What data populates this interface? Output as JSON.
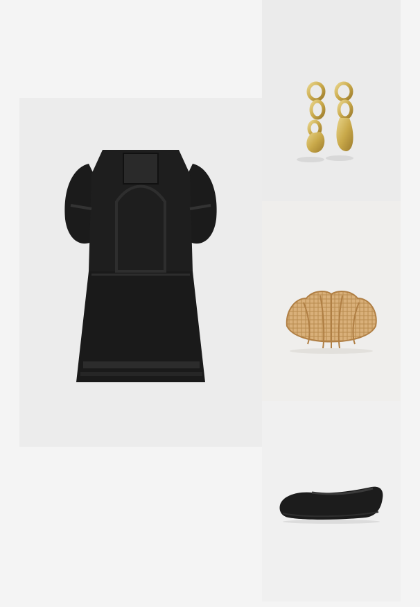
{
  "outfit": {
    "items": [
      {
        "kind": "dress",
        "color": "#1a1a1a",
        "icon": "dress-icon"
      },
      {
        "kind": "earrings",
        "color": "#c9a94a",
        "icon": "earrings-icon"
      },
      {
        "kind": "bag",
        "color": "#d9b07a",
        "icon": "bag-icon"
      },
      {
        "kind": "shoe",
        "color": "#1c1c1c",
        "icon": "shoe-icon"
      }
    ],
    "colors": {
      "page_background": "#f4f4f4",
      "tile_background": "#ececec"
    }
  }
}
